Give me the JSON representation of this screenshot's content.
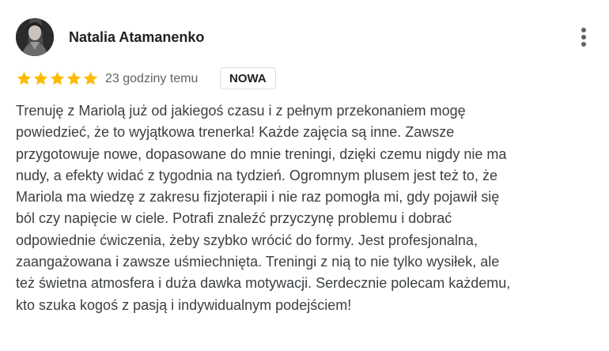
{
  "review": {
    "author": "Natalia Atamanenko",
    "rating": 5,
    "rating_max": 5,
    "time": "23 godziny temu",
    "badge": "NOWA",
    "text_lines": [
      "Trenuję z Mariolą już od jakiegoś czasu i z pełnym przekonaniem mogę",
      "powiedzieć, że to wyjątkowa trenerka! Każde zajęcia są inne. Zawsze",
      "przygotowuje nowe, dopasowane do mnie treningi, dzięki czemu nigdy nie ma",
      "nudy, a efekty widać z tygodnia na tydzień. Ogromnym plusem jest też to, że",
      "Mariola ma wiedzę z zakresu fizjoterapii i nie raz pomogła mi, gdy pojawił się",
      "ból czy napięcie w ciele. Potrafi znaleźć przyczynę problemu i dobrać",
      "odpowiednie ćwiczenia, żeby szybko wrócić do formy. Jest profesjonalna,",
      "zaangażowana i zawsze uśmiechnięta. Treningi z nią to nie tylko wysiłek, ale",
      "też świetna atmosfera i duża dawka motywacji. Serdecznie polecam każdemu,",
      "kto szuka kogoś z pasją i indywidualnym podejściem!"
    ]
  },
  "icons": {
    "avatar": "user-photo",
    "menu": "more-vertical-icon",
    "star": "star-filled-icon"
  },
  "colors": {
    "star": "#fbbc04",
    "text": "#3c4043",
    "secondary_text": "#5f6368",
    "badge_border": "#dadce0"
  }
}
